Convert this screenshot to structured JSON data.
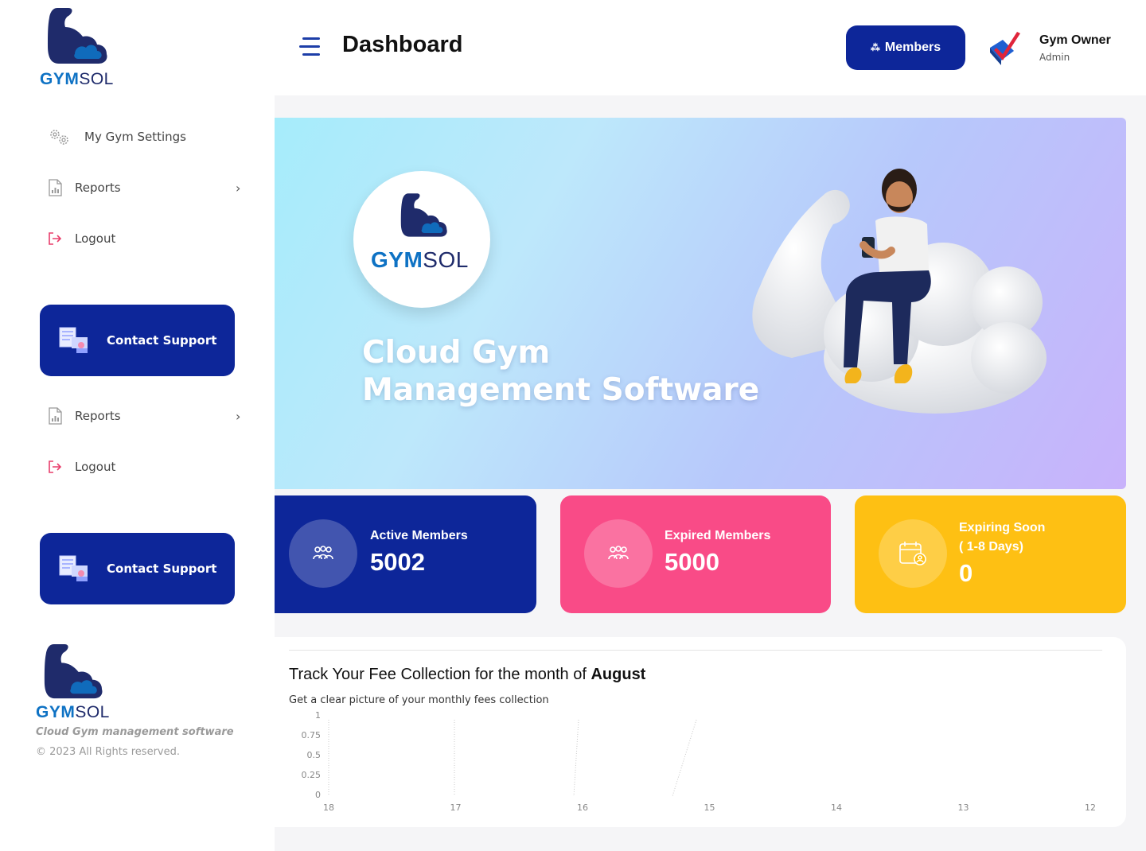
{
  "brand": {
    "gym": "GYM",
    "sol": "SOL"
  },
  "sidebar": {
    "items": [
      {
        "label": "My Gym Settings",
        "icon": "gear-icon"
      },
      {
        "label": "Reports",
        "icon": "report-icon",
        "has_submenu": true
      },
      {
        "label": "Logout",
        "icon": "logout-icon"
      },
      {
        "label": "Reports",
        "icon": "report-icon",
        "has_submenu": true
      },
      {
        "label": "Logout",
        "icon": "logout-icon"
      }
    ],
    "support_label": "Contact Support",
    "footer_tagline": "Cloud Gym management software",
    "footer_copyright": "© 2023 All Rights reserved."
  },
  "header": {
    "title": "Dashboard",
    "members_button": "Members",
    "user_name": "Gym Owner",
    "user_role": "Admin"
  },
  "hero": {
    "line1": "Cloud Gym",
    "line2": "Management Software"
  },
  "stats": [
    {
      "label": "Active Members",
      "value": "5002",
      "color": "#0d2699"
    },
    {
      "label": "Expired Members",
      "value": "5000",
      "color": "#f94b87"
    },
    {
      "label": "Expiring Soon",
      "sublabel": "( 1-8 Days)",
      "value": "0",
      "color": "#fec013"
    }
  ],
  "chart": {
    "title_prefix": "Track Your Fee Collection for the month of",
    "title_month": "August",
    "subtitle": "Get a clear picture of your monthly fees collection"
  },
  "chart_data": {
    "type": "line",
    "categories": [
      "18",
      "17",
      "16",
      "15",
      "14",
      "13",
      "12"
    ],
    "y_ticks": [
      "1",
      "0.75",
      "0.5",
      "0.25",
      "0"
    ],
    "ylim": [
      0,
      1
    ],
    "series": [
      {
        "values": [
          0,
          0,
          0,
          0,
          0,
          0,
          0
        ]
      }
    ],
    "grid": false,
    "xlabel": "",
    "ylabel": ""
  },
  "colors": {
    "primary": "#0d2699",
    "accent_pink": "#f94b87",
    "accent_yellow": "#fec013",
    "brand_blue": "#0e72c4",
    "brand_navy": "#1f2b6b"
  }
}
